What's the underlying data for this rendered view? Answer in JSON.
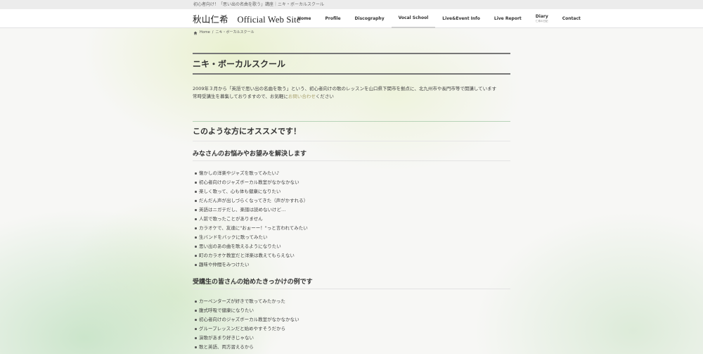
{
  "topbar": {
    "text": "初心者向け！「思い出の名曲を歌う」講座｜ニキ・ボーカルスクール"
  },
  "header": {
    "site_title": "秋山仁希　Official Web Site",
    "nav": [
      {
        "label": "Home"
      },
      {
        "label": "Profile"
      },
      {
        "label": "Discography"
      },
      {
        "label": "Vocal School",
        "active": true
      },
      {
        "label": "Live&Event Info"
      },
      {
        "label": "Live Report"
      },
      {
        "label": "Diary",
        "sub": "仁希の日記"
      },
      {
        "label": "Contact"
      }
    ]
  },
  "breadcrumb": {
    "home": "Home",
    "separator": "/",
    "current": "ニキ・ボーカルスクール"
  },
  "page": {
    "title": "ニキ・ボーカルスクール",
    "intro_line1": "2009年３月から「英語で思い出の名曲を歌う」という、初心者向けの歌のレッスンを山口県下関市を拠点に、北九州市や長門市等で開講しています",
    "intro_line2_prefix": "常時受講生を募集しておりますので、お気軽に",
    "intro_link": "お問い合わせ",
    "intro_line2_suffix": "ください",
    "section_title": "このような方にオススメです！",
    "sub1_title": "みなさんのお悩みやお望みを解決します",
    "sub1_items": [
      "懐かしの洋楽やジャズを歌ってみたい♪",
      "初心者向けのジャズボーカル教室がなかなかない",
      "楽しく歌って、心も体も健康になりたい",
      "だんだん声が出しづらくなってきた（声がかすれる）",
      "英語はニガテだし、楽譜は読めないけど…",
      "人前で歌ったことがありません",
      "カラオケで、友達に\"おぉーー！\"っと言われてみたい",
      "生バンドをバックに歌ってみたい",
      "思い出のあの曲を歌えるようになりたい",
      "町のカラオケ教室だと洋楽は教えてもらえない",
      "趣味や仲間をみつけたい"
    ],
    "sub2_title": "受講生の皆さんの始めたきっかけの例です",
    "sub2_items": [
      "カーペンターズが好きで歌ってみたかった",
      "腹式呼吸で健康になりたい",
      "初心者向けのジャズボーカル教室がなかなかない",
      "グループレッスンだと始めやすそうだから",
      "演歌があまり好きじゃない",
      "歌と英語、両方習えるから"
    ]
  }
}
